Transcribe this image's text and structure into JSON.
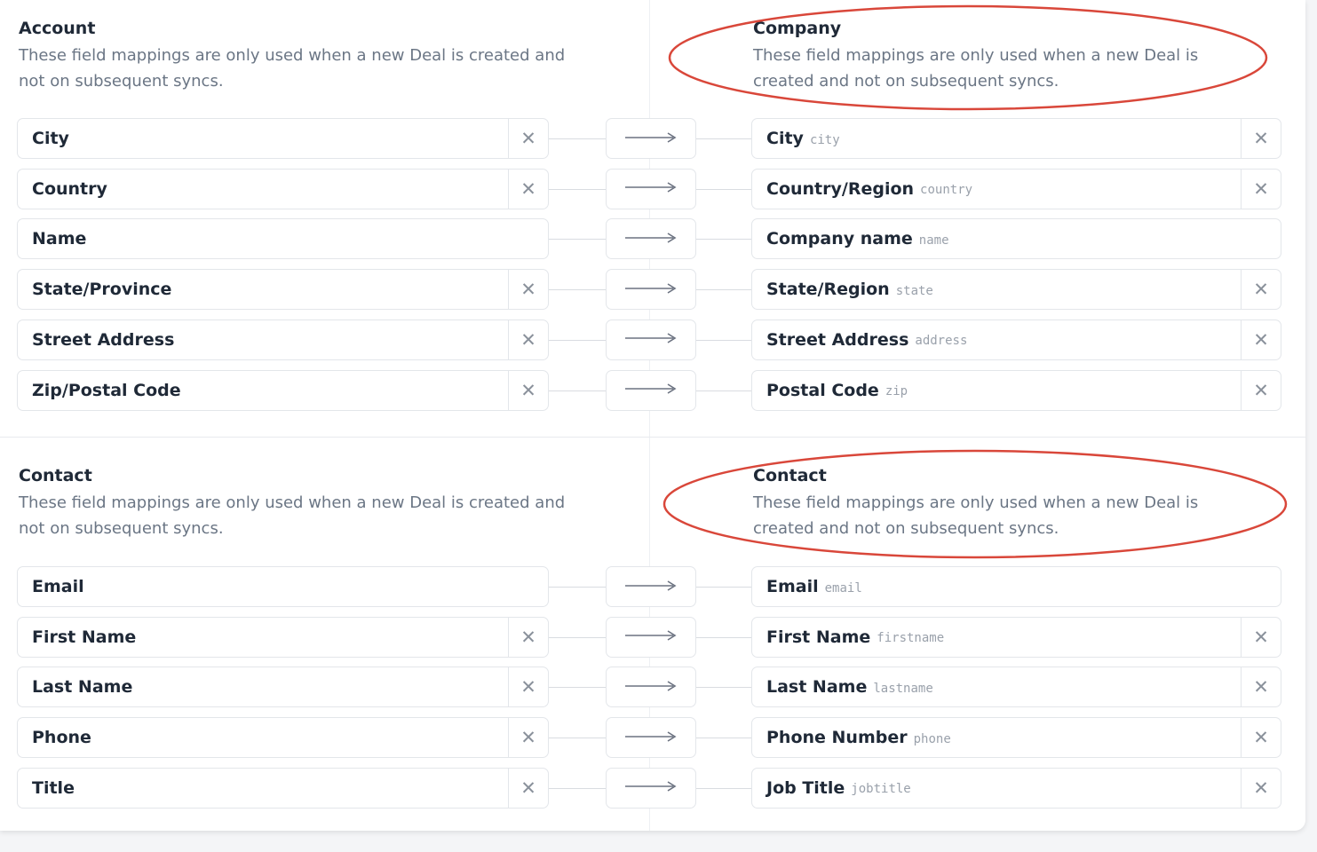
{
  "account_section": {
    "title": "Account",
    "description_line1": "These field mappings are only used when a new Deal is created and",
    "description_line2": "not on subsequent syncs."
  },
  "company_section": {
    "title": "Company",
    "description_line1": "These field mappings are only used when a new Deal is",
    "description_line2": "created and not on subsequent syncs."
  },
  "contact_left_section": {
    "title": "Contact",
    "description_line1": "These field mappings are only used when a new Deal is created and",
    "description_line2": "not on subsequent syncs."
  },
  "contact_right_section": {
    "title": "Contact",
    "description_line1": "These field mappings are only used when a new Deal is",
    "description_line2": "created and not on subsequent syncs."
  },
  "company_mappings": [
    {
      "source": "City",
      "target": "City",
      "target_key": "city"
    },
    {
      "source": "Country",
      "target": "Country/Region",
      "target_key": "country"
    },
    {
      "source": "Name",
      "target": "Company name",
      "target_key": "name"
    },
    {
      "source": "State/Province",
      "target": "State/Region",
      "target_key": "state"
    },
    {
      "source": "Street Address",
      "target": "Street Address",
      "target_key": "address"
    },
    {
      "source": "Zip/Postal Code",
      "target": "Postal Code",
      "target_key": "zip"
    }
  ],
  "contact_mappings": [
    {
      "source": "Email",
      "target": "Email",
      "target_key": "email"
    },
    {
      "source": "First Name",
      "target": "First Name",
      "target_key": "firstname"
    },
    {
      "source": "Last Name",
      "target": "Last Name",
      "target_key": "lastname"
    },
    {
      "source": "Phone",
      "target": "Phone Number",
      "target_key": "phone"
    },
    {
      "source": "Title",
      "target": "Job Title",
      "target_key": "jobtitle"
    }
  ],
  "clear_symbol": "✕",
  "annotation_color": "#d9473a"
}
